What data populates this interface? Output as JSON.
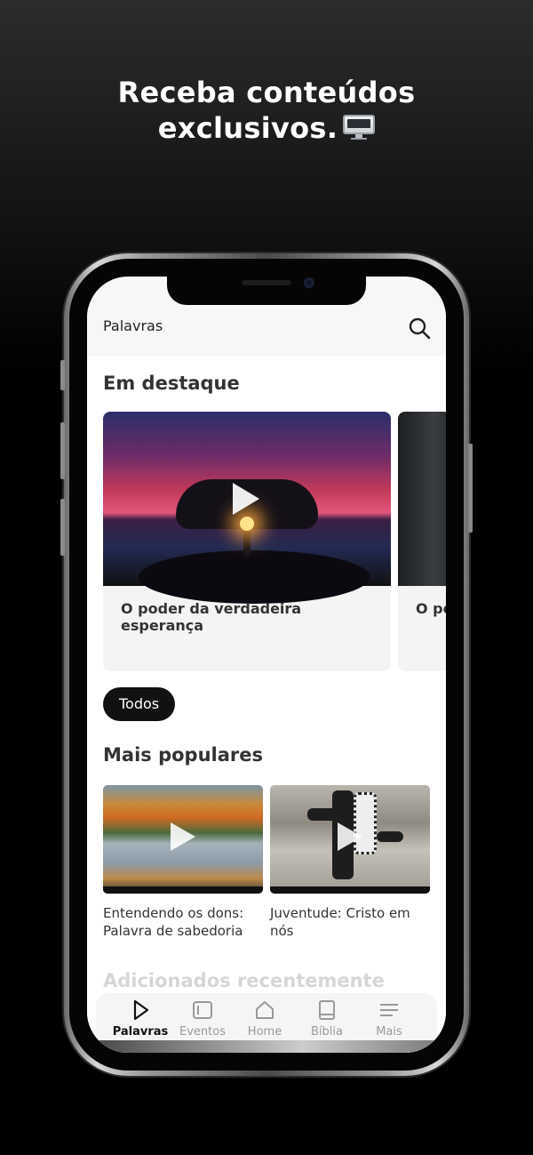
{
  "promo": {
    "headline_line1": "Receba conteúdos",
    "headline_line2": "exclusivos.",
    "emoji_icon": "desktop-computer-icon"
  },
  "app": {
    "header_title": "Palavras",
    "search_icon": "search-icon"
  },
  "featured": {
    "section_title": "Em destaque",
    "cards": [
      {
        "caption": "O poder da verdadeira esperança"
      },
      {
        "caption": "O po"
      }
    ]
  },
  "filter_chip": {
    "label": "Todos"
  },
  "popular": {
    "section_title": "Mais populares",
    "cards": [
      {
        "caption": "Entendendo os dons: Palavra de sabedoria"
      },
      {
        "caption": "Juventude: Cristo em nós"
      }
    ]
  },
  "recent": {
    "section_title": "Adicionados recentemente"
  },
  "tabbar": {
    "active": "Palavras",
    "items": [
      {
        "label": "Palavras",
        "icon": "play-icon"
      },
      {
        "label": "Eventos",
        "icon": "calendar-icon"
      },
      {
        "label": "Home",
        "icon": "home-icon"
      },
      {
        "label": "Bíblia",
        "icon": "book-icon"
      },
      {
        "label": "Mais",
        "icon": "menu-icon"
      }
    ]
  }
}
